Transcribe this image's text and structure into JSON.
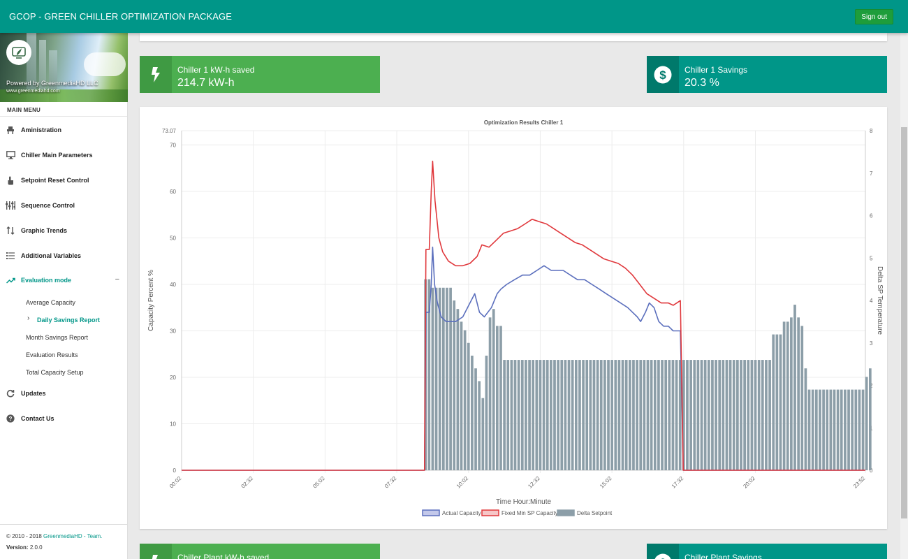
{
  "app": {
    "title": "GCOP - GREEN CHILLER OPTIMIZATION PACKAGE",
    "signout_label": "Sign out"
  },
  "brand": {
    "powered_by": "Powered by GreenmediaHD LLC",
    "url": "www.greenmediahd.com"
  },
  "sidebar": {
    "menu_header": "MAIN MENU",
    "items": [
      {
        "label": "Aministration",
        "icon": "chair-icon"
      },
      {
        "label": "Chiller Main Parameters",
        "icon": "monitor-icon"
      },
      {
        "label": "Setpoint Reset Control",
        "icon": "hand-pointer-icon"
      },
      {
        "label": "Sequence Control",
        "icon": "sliders-icon"
      },
      {
        "label": "Graphic Trends",
        "icon": "trends-icon"
      },
      {
        "label": "Additional Variables",
        "icon": "list-icon"
      },
      {
        "label": "Evaluation mode",
        "icon": "trending-up-icon",
        "active": true,
        "toggle": "−"
      },
      {
        "label": "Updates",
        "icon": "refresh-icon"
      },
      {
        "label": "Contact Us",
        "icon": "question-icon"
      }
    ],
    "submenu": [
      {
        "label": "Average Capacity"
      },
      {
        "label": "Daily Savings Report",
        "active": true
      },
      {
        "label": "Month Savings Report"
      },
      {
        "label": "Evaluation Results"
      },
      {
        "label": "Total Capacity Setup"
      }
    ],
    "footer": {
      "copyright_prefix": "© 2010 - 2018 ",
      "copyright_link": "GreenmediaHD - Team.",
      "version_label": "Version:",
      "version_value": "2.0.0"
    }
  },
  "infoboxes": [
    {
      "label": "Chiller 1 kW-h saved",
      "value": "214.7 kW-h",
      "icon": "bolt-icon",
      "color": "#4caf50"
    },
    {
      "label": "Chiller 1 Savings",
      "value": "20.3 %",
      "icon": "dollar-icon",
      "color": "#009688"
    },
    {
      "label": "Chiller Plant kW-h saved",
      "value": "",
      "icon": "bolt-icon",
      "color": "#4caf50"
    },
    {
      "label": "Chiller Plant Savings",
      "value": "",
      "icon": "dollar-icon",
      "color": "#009688"
    }
  ],
  "colors": {
    "primary": "#009688",
    "green": "#4caf50",
    "actual": "#5b6fbd",
    "fixed": "#e0383c",
    "delta": "#8c9ea8"
  },
  "chart_data": {
    "type": "line",
    "title": "Optimization Results Chiller 1",
    "xlabel": "Time Hour:Minute",
    "ylabel_left": "Capacity Percent %",
    "ylabel_right": "Delta SP Temperature",
    "ylim_left": [
      0,
      73.07
    ],
    "left_ticks": [
      "0",
      "10",
      "20",
      "30",
      "40",
      "50",
      "60",
      "70",
      "73.07"
    ],
    "ylim_right": [
      0,
      8
    ],
    "right_ticks": [
      "0",
      "1",
      "2",
      "3",
      "4",
      "5",
      "6",
      "7",
      "8"
    ],
    "x_tick_labels": [
      "00:02",
      "02:32",
      "05:02",
      "07:32",
      "10:02",
      "12:32",
      "15:02",
      "17:32",
      "20:02",
      "23:52"
    ],
    "x_tick_minutes": [
      2,
      152,
      302,
      452,
      602,
      752,
      902,
      1052,
      1202,
      1432
    ],
    "x_range_minutes": [
      2,
      1432
    ],
    "grid": true,
    "legend_position": "bottom",
    "series": [
      {
        "name": "Actual Capacity",
        "kind": "line",
        "axis": "left",
        "points": [
          [
            2,
            0
          ],
          [
            510,
            0
          ],
          [
            513,
            34
          ],
          [
            520,
            34
          ],
          [
            524,
            40
          ],
          [
            527,
            48
          ],
          [
            531,
            40
          ],
          [
            537,
            36
          ],
          [
            545,
            33
          ],
          [
            555,
            32
          ],
          [
            575,
            32
          ],
          [
            590,
            33
          ],
          [
            600,
            35
          ],
          [
            615,
            38
          ],
          [
            625,
            34
          ],
          [
            635,
            33
          ],
          [
            650,
            35
          ],
          [
            662,
            38
          ],
          [
            670,
            39
          ],
          [
            682,
            40
          ],
          [
            698,
            41
          ],
          [
            715,
            42
          ],
          [
            730,
            42
          ],
          [
            745,
            43
          ],
          [
            760,
            44
          ],
          [
            775,
            43
          ],
          [
            800,
            43
          ],
          [
            815,
            42
          ],
          [
            830,
            41
          ],
          [
            845,
            41
          ],
          [
            860,
            40
          ],
          [
            875,
            39
          ],
          [
            890,
            38
          ],
          [
            905,
            37
          ],
          [
            920,
            36
          ],
          [
            935,
            35
          ],
          [
            945,
            34
          ],
          [
            955,
            33
          ],
          [
            962,
            32
          ],
          [
            972,
            34
          ],
          [
            980,
            36
          ],
          [
            990,
            35
          ],
          [
            1000,
            32
          ],
          [
            1010,
            31
          ],
          [
            1020,
            31
          ],
          [
            1030,
            30
          ],
          [
            1040,
            30
          ],
          [
            1045,
            30
          ],
          [
            1051,
            0
          ],
          [
            1432,
            0
          ]
        ]
      },
      {
        "name": "Fixed Min SP Capacity",
        "kind": "line",
        "axis": "left",
        "points": [
          [
            2,
            0
          ],
          [
            510,
            0
          ],
          [
            513,
            47.5
          ],
          [
            520,
            47.5
          ],
          [
            524,
            60
          ],
          [
            527,
            66.5
          ],
          [
            532,
            58
          ],
          [
            540,
            50
          ],
          [
            548,
            47
          ],
          [
            560,
            45
          ],
          [
            575,
            44
          ],
          [
            590,
            44
          ],
          [
            605,
            44.5
          ],
          [
            620,
            46
          ],
          [
            630,
            48.5
          ],
          [
            645,
            48
          ],
          [
            660,
            49.5
          ],
          [
            675,
            51
          ],
          [
            690,
            51.5
          ],
          [
            705,
            52
          ],
          [
            720,
            53
          ],
          [
            735,
            54
          ],
          [
            750,
            53.5
          ],
          [
            765,
            53
          ],
          [
            780,
            52
          ],
          [
            795,
            51
          ],
          [
            810,
            50
          ],
          [
            825,
            49
          ],
          [
            840,
            48.5
          ],
          [
            855,
            47.5
          ],
          [
            870,
            46.5
          ],
          [
            885,
            45.5
          ],
          [
            900,
            45
          ],
          [
            915,
            44.5
          ],
          [
            930,
            43.5
          ],
          [
            945,
            42
          ],
          [
            960,
            40
          ],
          [
            975,
            38
          ],
          [
            990,
            37
          ],
          [
            1005,
            36
          ],
          [
            1020,
            36
          ],
          [
            1030,
            35.5
          ],
          [
            1045,
            36.5
          ],
          [
            1051,
            0
          ],
          [
            1432,
            0
          ]
        ]
      },
      {
        "name": "Delta Setpoint",
        "kind": "bar",
        "axis": "right",
        "bar_start_minute": 512,
        "bar_step_minutes": 7.5,
        "values": [
          4.5,
          4.5,
          4.3,
          4.3,
          4.3,
          4.3,
          4.3,
          4.3,
          4.0,
          3.8,
          3.5,
          3.3,
          3.0,
          2.7,
          2.4,
          2.1,
          1.7,
          2.7,
          3.6,
          3.8,
          3.4,
          3.4,
          2.6,
          2.6,
          2.6,
          2.6,
          2.6,
          2.6,
          2.6,
          2.6,
          2.6,
          2.6,
          2.6,
          2.6,
          2.6,
          2.6,
          2.6,
          2.6,
          2.6,
          2.6,
          2.6,
          2.6,
          2.6,
          2.6,
          2.6,
          2.6,
          2.6,
          2.6,
          2.6,
          2.6,
          2.6,
          2.6,
          2.6,
          2.6,
          2.6,
          2.6,
          2.6,
          2.6,
          2.6,
          2.6,
          2.6,
          2.6,
          2.6,
          2.6,
          2.6,
          2.6,
          2.6,
          2.6,
          2.6,
          2.6,
          2.6,
          2.6,
          2.6,
          2.6,
          2.6,
          2.6,
          2.6,
          2.6,
          2.6,
          2.6,
          2.6,
          2.6,
          2.6,
          2.6,
          2.6,
          2.6,
          2.6,
          2.6,
          2.6,
          2.6,
          2.6,
          2.6,
          2.6,
          2.6,
          2.6,
          2.6,
          2.6,
          3.2,
          3.2,
          3.2,
          3.5,
          3.5,
          3.6,
          3.9,
          3.6,
          3.4,
          2.4,
          1.9,
          1.9,
          1.9,
          1.9,
          1.9,
          1.9,
          1.9,
          1.9,
          1.9,
          1.9,
          1.9,
          1.9,
          1.9,
          1.9,
          1.9,
          1.9,
          2.2,
          2.4
        ]
      }
    ]
  }
}
